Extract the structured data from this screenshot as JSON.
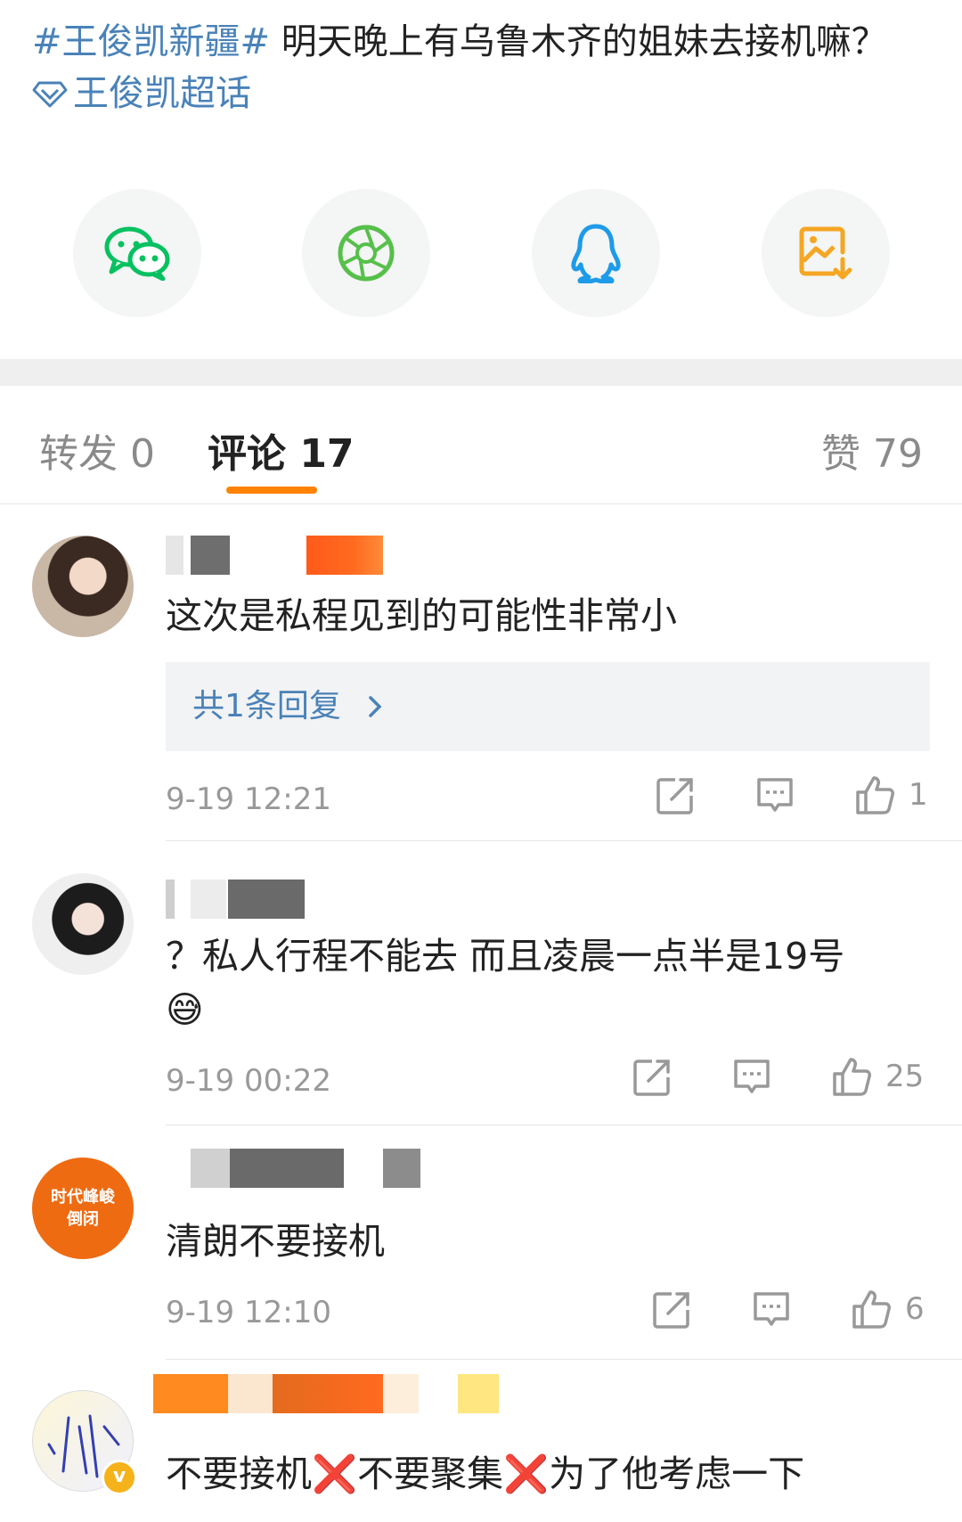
{
  "post": {
    "hashtag": "#王俊凯新疆#",
    "text": " 明天晚上有乌鲁木齐的姐妹去接机嘛？",
    "topic_label": "王俊凯超话"
  },
  "share": [
    {
      "icon": "wechat-icon",
      "color": "#07c160"
    },
    {
      "icon": "moments-icon",
      "color": "#56c04a"
    },
    {
      "icon": "qq-icon",
      "color": "#1e9be8"
    },
    {
      "icon": "save-image-icon",
      "color": "#f5a623"
    }
  ],
  "tabs": {
    "repost": "转发 0",
    "comments": "评论 17",
    "likes": "赞 79",
    "accent": "#ff8200"
  },
  "comments": [
    {
      "text": "这次是私程见到的可能性非常小",
      "reply_label": "共1条回复",
      "time": "9-19 12:21",
      "likes": "1"
    },
    {
      "text": "？私人行程不能去 而且凌晨一点半是19号",
      "emoji": "😅",
      "time": "9-19 00:22",
      "likes": "25"
    },
    {
      "avatar_text_1": "时代峰峻",
      "avatar_text_2": "倒闭",
      "text": "清朗不要接机",
      "time": "9-19 12:10",
      "likes": "6"
    },
    {
      "text_part1": "不要接机",
      "text_part2": "不要聚集",
      "text_part3": "为了他考虑一下",
      "cross": "❌",
      "badge": "v"
    }
  ]
}
